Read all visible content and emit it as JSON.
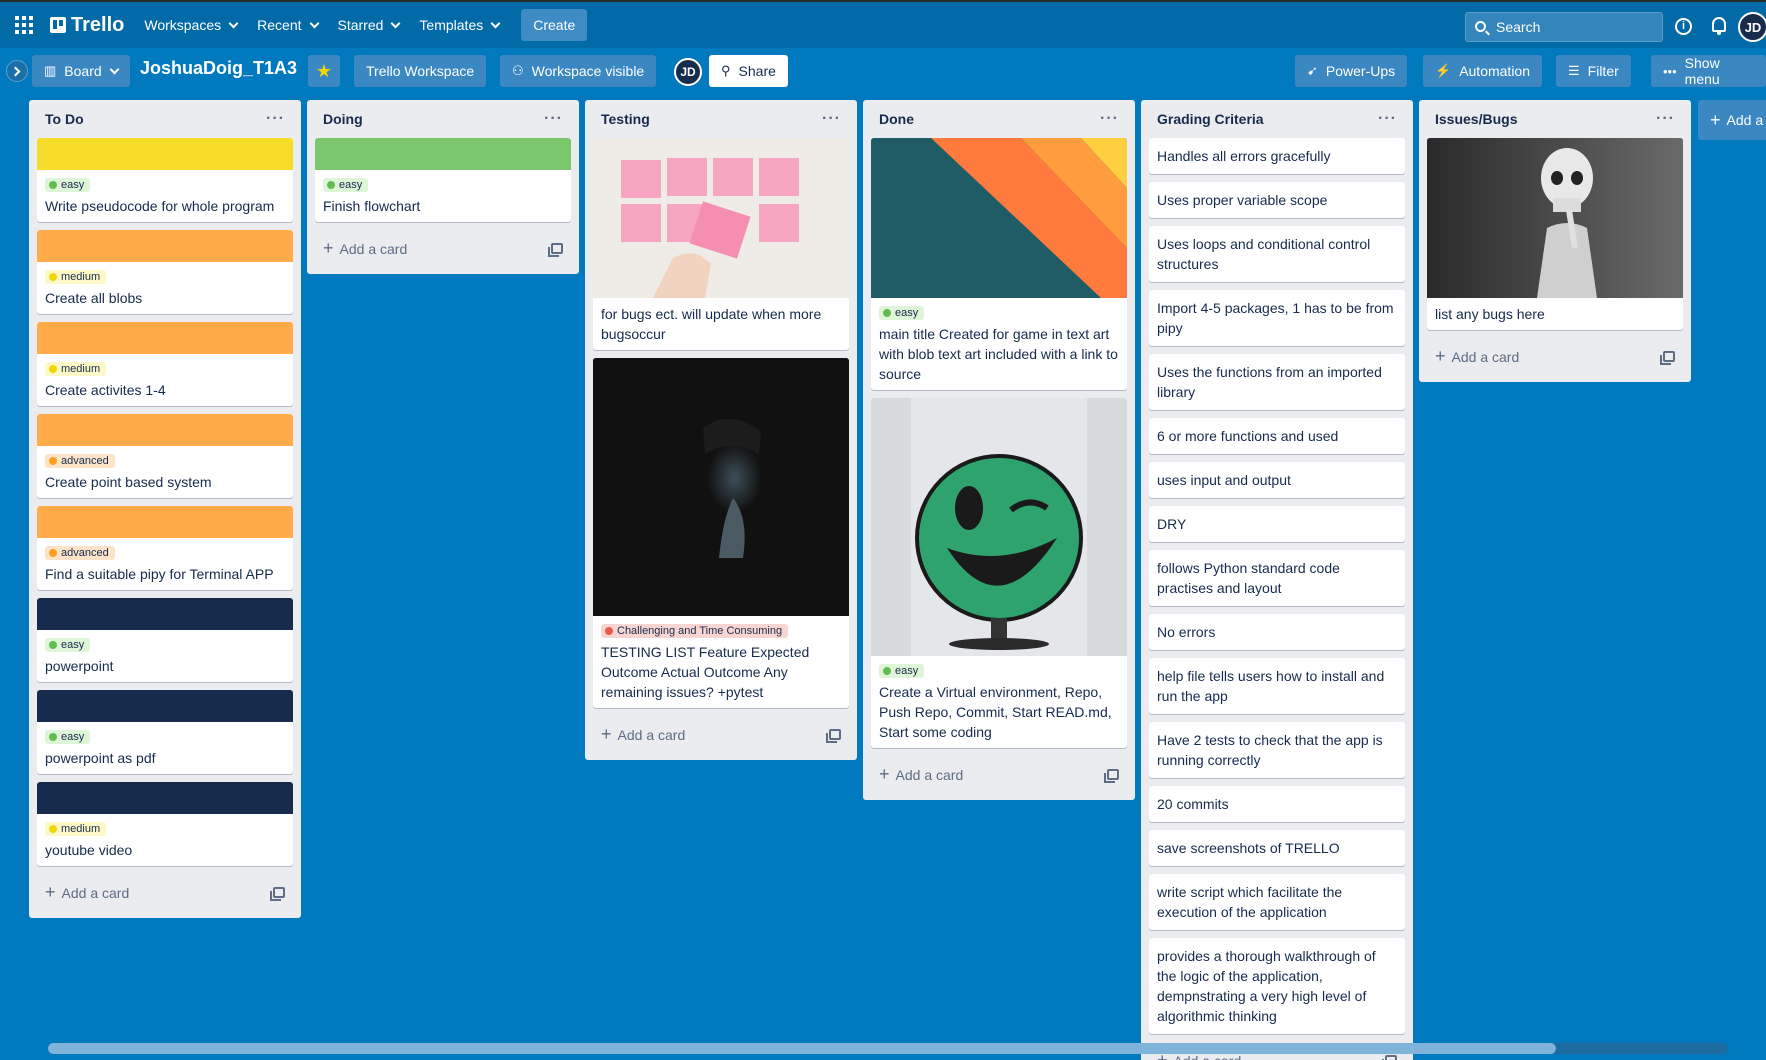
{
  "topnav": {
    "logo": "Trello",
    "workspaces": "Workspaces",
    "recent": "Recent",
    "starred": "Starred",
    "templates": "Templates",
    "create": "Create",
    "search_placeholder": "Search",
    "avatar": "JD"
  },
  "board": {
    "view": "Board",
    "title": "JoshuaDoig_T1A3",
    "workspace": "Trello Workspace",
    "visibility": "Workspace visible",
    "member": "JD",
    "share": "Share",
    "powerups": "Power-Ups",
    "automation": "Automation",
    "filter": "Filter",
    "show_menu": "Show menu",
    "add_list": "Add a"
  },
  "colors": {
    "yellow": "#f5dd29",
    "orange": "#ffab4a",
    "green": "#7bc86c",
    "navy": "#172b4d"
  },
  "add_card": "Add a card",
  "lists": {
    "todo": {
      "title": "To Do",
      "cards": [
        {
          "label": "easy",
          "title": "Write pseudocode for whole program"
        },
        {
          "label": "medium",
          "title": "Create all blobs"
        },
        {
          "label": "medium",
          "title": "Create activites 1-4"
        },
        {
          "label": "advanced",
          "title": "Create point based system"
        },
        {
          "label": "advanced",
          "title": "Find a suitable pipy for Terminal APP"
        },
        {
          "label": "easy",
          "title": "powerpoint"
        },
        {
          "label": "easy",
          "title": "powerpoint as pdf"
        },
        {
          "label": "medium",
          "title": "youtube video"
        }
      ]
    },
    "doing": {
      "title": "Doing",
      "cards": [
        {
          "label": "easy",
          "title": "Finish flowchart"
        }
      ]
    },
    "testing": {
      "title": "Testing",
      "cards": [
        {
          "title": "for bugs ect. will update when more bugsoccur"
        },
        {
          "label": "Challenging and Time Consuming",
          "title": "TESTING LIST Feature Expected Outcome Actual Outcome Any remaining issues? +pytest"
        }
      ]
    },
    "done": {
      "title": "Done",
      "cards": [
        {
          "label": "easy",
          "title": "main title Created for game in text art with blob text art included with a link to source"
        },
        {
          "label": "easy",
          "title": "Create a Virtual environment, Repo, Push Repo, Commit, Start READ.md, Start some coding"
        }
      ]
    },
    "grading": {
      "title": "Grading Criteria",
      "cards": [
        "Handles all errors gracefully",
        "Uses proper variable scope",
        "Uses loops and conditional control structures",
        "Import 4-5 packages, 1 has to be from pipy",
        "Uses the functions from an imported library",
        "6 or more functions and used",
        "uses input and output",
        "DRY",
        "follows Python standard code practises and layout",
        "No errors",
        "help file tells users how to install and run the app",
        "Have 2 tests to check that the app is running correctly",
        "20 commits",
        "save screenshots of TRELLO",
        "write script which facilitate the execution of the application",
        "provides a thorough walkthrough of the logic of the application, dempnstrating a very high level of algorithmic thinking"
      ]
    },
    "issues": {
      "title": "Issues/Bugs",
      "cards": [
        {
          "title": "list any bugs here"
        }
      ]
    }
  }
}
